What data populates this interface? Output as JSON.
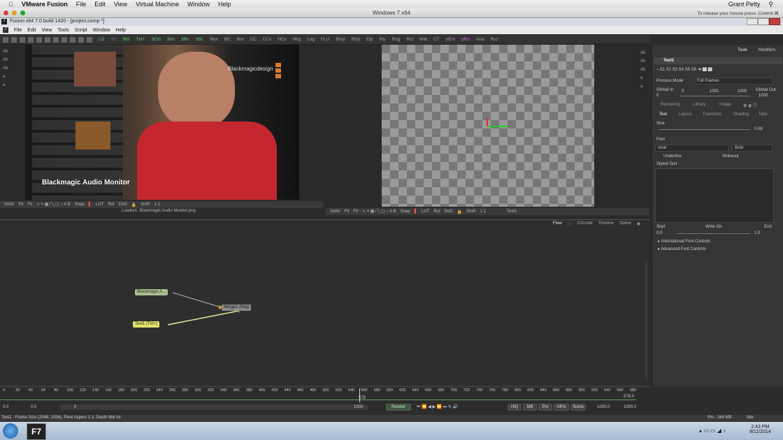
{
  "mac_menu": {
    "apple": "",
    "app": "VMware Fusion",
    "items": [
      "File",
      "Edit",
      "View",
      "Virtual Machine",
      "Window",
      "Help"
    ],
    "user": "Grant Petty"
  },
  "vm_window": {
    "title": "Windows 7 x64",
    "release_hint": "To release your mouse press: Control-⌘"
  },
  "fusion": {
    "title": "Fusion x64 7.0 build 1420 - [project.comp *]",
    "menu": [
      "File",
      "Edit",
      "View",
      "Tools",
      "Script",
      "Window",
      "Help"
    ],
    "toolbar": [
      "LD",
      "SV",
      "BG",
      "Txt+",
      "3Cm",
      "3Im",
      "3Rn",
      "3SL",
      "Blur",
      "BC",
      "Bol",
      "CC",
      "CCv",
      "HCv",
      "Mrg",
      "Log",
      "FLU",
      "Bmp",
      "BSp",
      "Elp",
      "Ply",
      "Rng",
      "Rct",
      "Mat",
      "CT",
      "pEm",
      "pRn",
      "Ana",
      "Rsz"
    ],
    "left_viewer": {
      "overlay_text": "Blackmagic Audio Monitor",
      "logo_text": "Blackmagicdesign",
      "controls": [
        "SubV",
        "Fit",
        "Fit",
        "Snap",
        "LUT",
        "RoI",
        "DoD",
        "SmR",
        "1:1"
      ],
      "status": "Loader1: Blackmagic Audio Monitor.png"
    },
    "right_viewer": {
      "controls": [
        "SubV",
        "Fit",
        "Fit",
        "Snap",
        "LUT",
        "RoI",
        "DoD",
        "SmR",
        "1:1"
      ],
      "status": "Text1"
    },
    "flow_tabs": [
      "Flow",
      "Console",
      "Timeline",
      "Spline"
    ],
    "nodes": {
      "loader": "Blackmagic A...",
      "merge": "Merge1 (Mrg)",
      "text": "Text1 (Txt+)"
    },
    "inspector": {
      "tabs": [
        "Tools",
        "Modifiers"
      ],
      "tool_name": "Text1",
      "process_mode_label": "Process Mode",
      "process_mode_value": "Full Frames",
      "global_in_label": "Global In",
      "global_in_value": "0",
      "global_mid": "1001",
      "global_end": "1000",
      "global_out_label": "Global Out",
      "global_out_value": "1000",
      "rendering_tabs": [
        "Rendering",
        "Library",
        "Image"
      ],
      "sub_tabs": [
        "Text",
        "Layout",
        "Transform",
        "Shading",
        "Tabs"
      ],
      "size_label": "Size",
      "size_value": "0.08",
      "font_label": "Font",
      "font_value": "Arial",
      "font_style": "Bold",
      "underline_label": "Underline",
      "strikeout_label": "Strikeout",
      "styled_text_label": "Styled Text",
      "start_label": "Start",
      "start_value": "0.0",
      "write_on_label": "Write On",
      "end_label": "End",
      "end_value": "1.0",
      "int_font": "International Font Controls",
      "adv_font": "Advanced Font Controls"
    },
    "timeline": {
      "ticks": [
        "0",
        "20",
        "40",
        "60",
        "80",
        "100",
        "120",
        "140",
        "160",
        "180",
        "200",
        "220",
        "240",
        "260",
        "280",
        "300",
        "320",
        "340",
        "360",
        "380",
        "400",
        "420",
        "440",
        "460",
        "480",
        "500",
        "520",
        "540",
        "560",
        "580",
        "600",
        "620",
        "640",
        "660",
        "680",
        "700",
        "720",
        "740",
        "760",
        "780",
        "800",
        "820",
        "840",
        "860",
        "880",
        "900",
        "920",
        "940",
        "960",
        "980"
      ],
      "current": "578",
      "end_field": "578.0",
      "left_vals": [
        "0.0",
        "0.0"
      ],
      "mid_val": "0",
      "range_end": "1000",
      "render_label": "Render",
      "hiq": "HiQ",
      "mb": "MB",
      "prx": "Prx",
      "aprx": "APrx",
      "some": "Some",
      "end_time": "1000.0",
      "end_time2": "1000.0"
    },
    "status_left": "Text1 - Frame Size (2048, 1556), Pixel Aspect 1:1, Depth 8bit int",
    "status_right": "9% - 348 MB",
    "status_idle": "Idle"
  },
  "taskbar": {
    "time": "2:43 PM",
    "date": "9/11/2014",
    "app_label": "F7"
  },
  "colors": {
    "flow_bg": "#2e2e2e",
    "node_loader": "#a9c08e",
    "node_text": "#e3e36a",
    "node_merge": "#8a8a8a"
  }
}
